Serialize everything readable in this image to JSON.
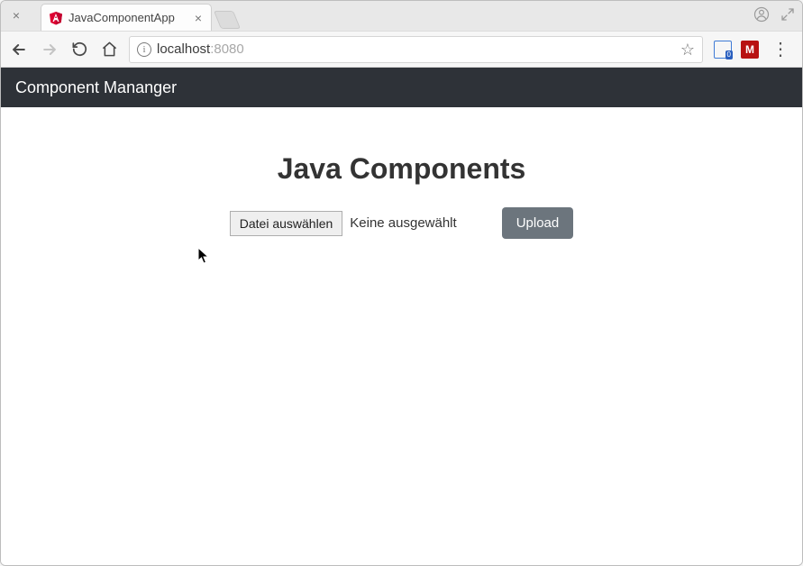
{
  "browser": {
    "tab": {
      "title": "JavaComponentApp",
      "favicon_label": "angular-icon"
    },
    "url": {
      "host": "localhost",
      "port": ":8080"
    },
    "ext_blue_badge": "0"
  },
  "app": {
    "navbar_title": "Component Mananger",
    "page_heading": "Java Components",
    "file_button_label": "Datei auswählen",
    "file_status": "Keine ausgewählt",
    "upload_label": "Upload"
  }
}
